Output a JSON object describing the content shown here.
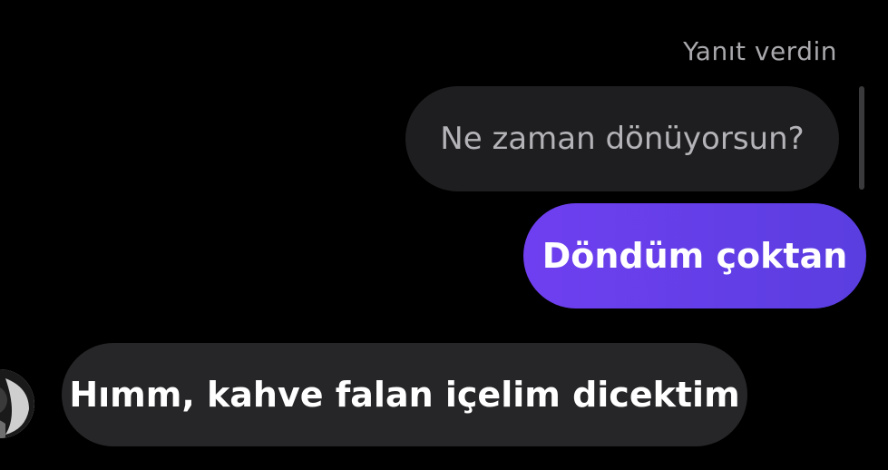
{
  "reply": {
    "label": "Yanıt verdin",
    "quoted_text": "Ne zaman dönüyorsun?"
  },
  "messages": [
    {
      "from": "me",
      "text": "Döndüm çoktan"
    },
    {
      "from": "them",
      "text": "Hımm, kahve falan içelim dicektim"
    }
  ],
  "colors": {
    "background": "#000000",
    "sent_bubble": "#6a3fea",
    "received_bubble": "#262628",
    "quoted_bubble": "#1e1e20"
  }
}
